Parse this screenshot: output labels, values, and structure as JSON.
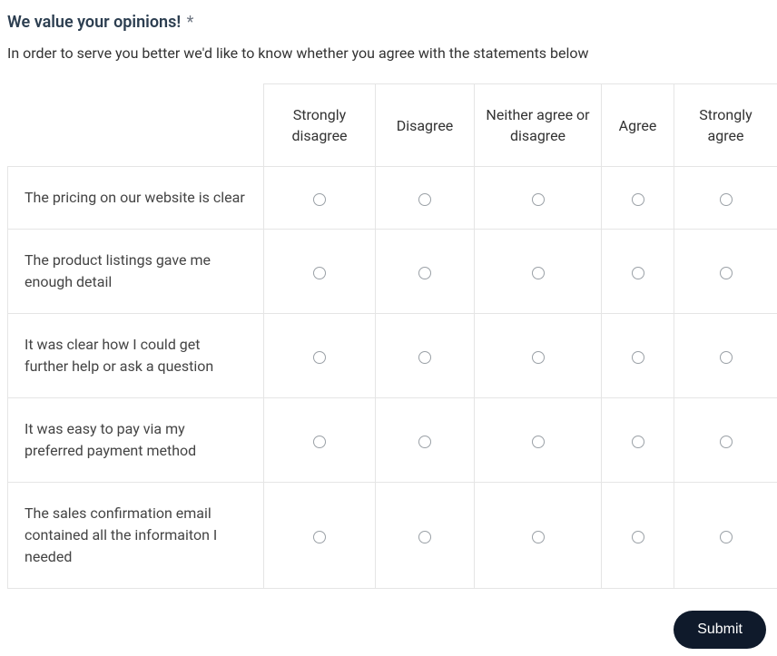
{
  "question": {
    "title": "We value your opinions!",
    "required_marker": "*",
    "description": "In order to serve you better we'd like to know whether you agree with the statements below"
  },
  "scale": {
    "col1": "Strongly disagree",
    "col2": "Disagree",
    "col3": "Neither agree or disagree",
    "col4": "Agree",
    "col5": "Strongly agree"
  },
  "rows": {
    "r1": "The pricing on our website is clear",
    "r2": "The product listings gave me enough detail",
    "r3": "It was clear how I could get further help or ask a question",
    "r4": "It was easy to pay via my preferred payment method",
    "r5": "The sales confirmation email contained all the informaiton I needed"
  },
  "submit": {
    "label": "Submit"
  }
}
